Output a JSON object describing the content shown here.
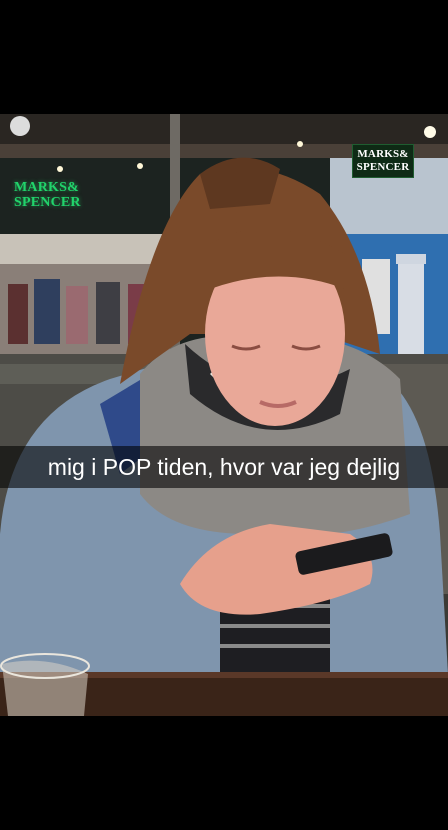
{
  "snap": {
    "caption": "mig i POP tiden, hvor var jeg dejlig"
  },
  "photo": {
    "store_sign_left": {
      "line1": "MARKS&",
      "line2": "SPENCER"
    },
    "store_sign_right": {
      "line1": "MARKS&",
      "line2": "SPENCER"
    }
  },
  "colors": {
    "letterbox": "#000000",
    "caption_bar": "rgba(0,0,0,0.58)",
    "caption_text": "#ffffff",
    "sign_green": "#21d36b"
  }
}
